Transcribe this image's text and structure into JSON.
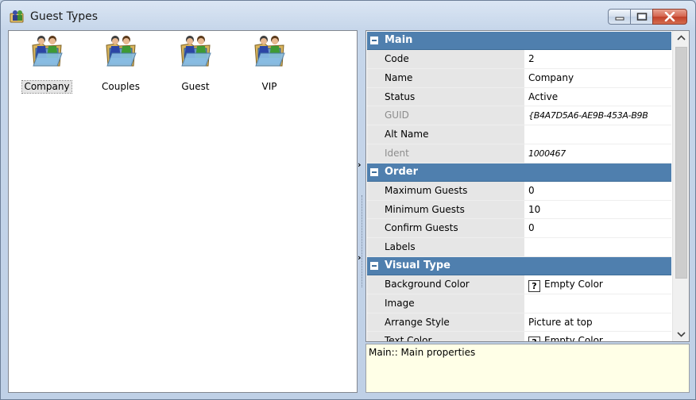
{
  "window": {
    "title": "Guest Types"
  },
  "icons": [
    {
      "label": "Company",
      "selected": true
    },
    {
      "label": "Couples",
      "selected": false
    },
    {
      "label": "Guest",
      "selected": false
    },
    {
      "label": "VIP",
      "selected": false
    }
  ],
  "grid": {
    "categories": [
      {
        "label": "Main",
        "rows": [
          {
            "name": "Code",
            "value": "2",
            "readonly": false
          },
          {
            "name": "Name",
            "value": "Company",
            "readonly": false
          },
          {
            "name": "Status",
            "value": "Active",
            "readonly": false
          },
          {
            "name": "GUID",
            "value": "{B4A7D5A6-AE9B-453A-B9B",
            "readonly": true
          },
          {
            "name": "Alt Name",
            "value": "",
            "readonly": false
          },
          {
            "name": "Ident",
            "value": "1000467",
            "readonly": true
          }
        ]
      },
      {
        "label": "Order",
        "rows": [
          {
            "name": "Maximum Guests",
            "value": "0",
            "readonly": false
          },
          {
            "name": "Minimum Guests",
            "value": "10",
            "readonly": false
          },
          {
            "name": "Confirm Guests",
            "value": "0",
            "readonly": false
          },
          {
            "name": "Labels",
            "value": "",
            "readonly": false
          }
        ]
      },
      {
        "label": "Visual Type",
        "rows": [
          {
            "name": "Background Color",
            "value": "Empty Color",
            "readonly": false,
            "color_picker": true
          },
          {
            "name": "Image",
            "value": "",
            "readonly": false
          },
          {
            "name": "Arrange Style",
            "value": "Picture at top",
            "readonly": false
          },
          {
            "name": "Text Color",
            "value": "Empty Color",
            "readonly": false,
            "color_picker": true
          }
        ]
      }
    ]
  },
  "description": {
    "text": "Main:: Main properties"
  },
  "colors": {
    "category_header": "#4f7fae",
    "description_bg": "#ffffe7",
    "name_column_bg": "#e6e6e6"
  }
}
